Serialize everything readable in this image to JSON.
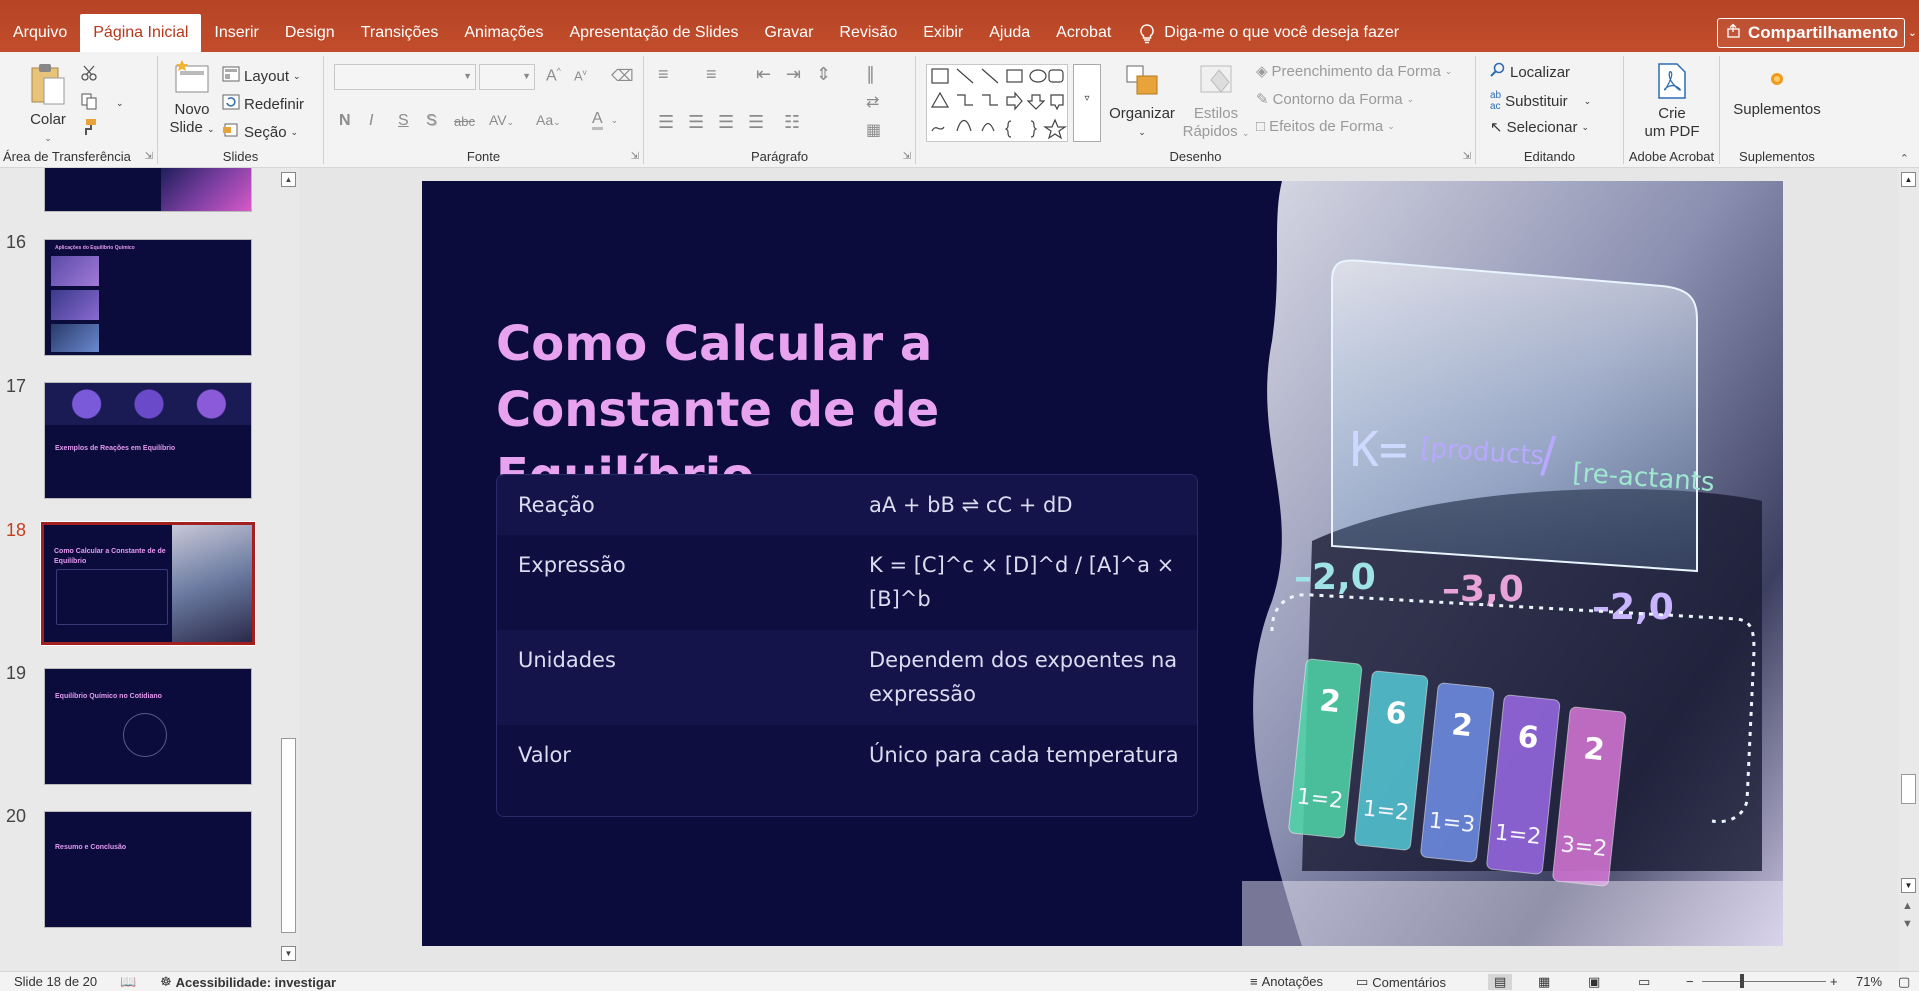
{
  "menu": {
    "tabs": [
      "Arquivo",
      "Página Inicial",
      "Inserir",
      "Design",
      "Transições",
      "Animações",
      "Apresentação de Slides",
      "Gravar",
      "Revisão",
      "Exibir",
      "Ajuda",
      "Acrobat"
    ],
    "active_tab": "Página Inicial",
    "tell_me": "Diga-me o que você deseja fazer",
    "share": "Compartilhamento"
  },
  "ribbon": {
    "clipboard": {
      "label": "Área de Transferência",
      "paste": "Colar"
    },
    "slides": {
      "label": "Slides",
      "new_slide_1": "Novo",
      "new_slide_2": "Slide",
      "layout": "Layout",
      "reset": "Redefinir",
      "section": "Seção"
    },
    "font": {
      "label": "Fonte",
      "bold": "N",
      "italic": "I",
      "underline": "S",
      "shadow": "S",
      "strike": "abc",
      "spacing": "AV",
      "case": "Aa",
      "color": "A",
      "grow": "A",
      "shrink": "A"
    },
    "paragraph": {
      "label": "Parágrafo"
    },
    "drawing": {
      "label": "Desenho",
      "arrange": "Organizar",
      "quick_styles_1": "Estilos",
      "quick_styles_2": "Rápidos",
      "fill": "Preenchimento da Forma",
      "outline": "Contorno da Forma",
      "effects": "Efeitos de Forma"
    },
    "editing": {
      "label": "Editando",
      "find": "Localizar",
      "replace": "Substituir",
      "select": "Selecionar"
    },
    "acrobat": {
      "label": "Adobe Acrobat",
      "create_pdf_1": "Crie",
      "create_pdf_2": "um PDF"
    },
    "addins": {
      "label": "Suplementos",
      "addins_btn": "Suplementos"
    }
  },
  "thumbnails": [
    {
      "num": "16",
      "title": "Aplicações do Equilíbrio Químico"
    },
    {
      "num": "17",
      "title": "Exemplos de Reações em Equilíbrio"
    },
    {
      "num": "18",
      "title": "Como Calcular a Constante de de Equilíbrio"
    },
    {
      "num": "19",
      "title": "Equilíbrio Químico no Cotidiano"
    },
    {
      "num": "20",
      "title": "Resumo e Conclusão"
    }
  ],
  "slide": {
    "title": "Como Calcular a Constante de de Equilíbrio",
    "rows": [
      {
        "label": "Reação",
        "value": "aA + bB ⇌ cC + dD"
      },
      {
        "label": "Expressão",
        "value": "K = [C]^c × [D]^d / [A]^a × [B]^b"
      },
      {
        "label": "Unidades",
        "value": "Dependem dos expoentes na expressão"
      },
      {
        "label": "Valor",
        "value": "Único para cada temperatura"
      }
    ],
    "image": {
      "formula_k": "K=",
      "formula_num": "[products",
      "formula_den": "[re-actants",
      "numbers": [
        "–2,0",
        "–3,0",
        "–2,0"
      ],
      "cards": [
        {
          "top": "2",
          "bottom": "1=2",
          "color": "#4fd6a8"
        },
        {
          "top": "6",
          "bottom": "1=2",
          "color": "#55c9d6"
        },
        {
          "top": "2",
          "bottom": "1=3",
          "color": "#6f8fe6"
        },
        {
          "top": "6",
          "bottom": "1=2",
          "color": "#9a6ae6"
        },
        {
          "top": "2",
          "bottom": "3=2",
          "color": "#d878d8"
        }
      ]
    }
  },
  "status": {
    "slide_count": "Slide 18 de 20",
    "accessibility": "Acessibilidade: investigar",
    "notes": "Anotações",
    "comments": "Comentários",
    "zoom": "71%"
  }
}
